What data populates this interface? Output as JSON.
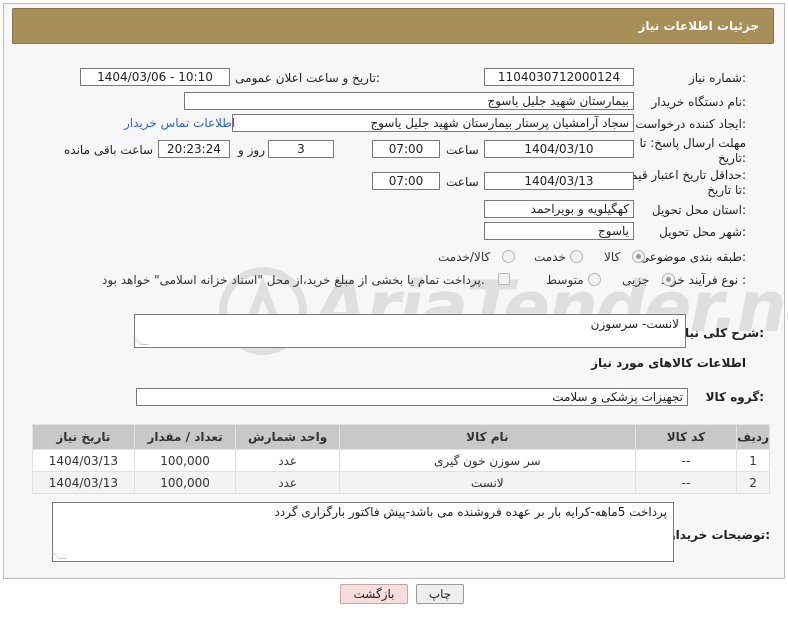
{
  "header": {
    "title": "جزئیات اطلاعات نیاز"
  },
  "fields": {
    "need_number_label": "شماره نیاز:",
    "need_number": "1104030712000124",
    "announce_label": "تاریخ و ساعت اعلان عمومی:",
    "announce_value": "1404/03/06 - 10:10",
    "buyer_org_label": "نام دستگاه خریدار:",
    "buyer_org": "بیمارستان شهید جلیل یاسوج",
    "creator_label": "ایجاد کننده درخواست:",
    "creator": "سجاد آرامشیان پرستار بیمارستان شهید جلیل یاسوج",
    "contact_link": "اطلاعات تماس خریدار",
    "deadline_label_1": "مهلت ارسال پاسخ: تا",
    "deadline_label_2": "تاریخ:",
    "deadline_date": "1404/03/10",
    "time_label": "ساعت",
    "deadline_time": "07:00",
    "days_value": "3",
    "days_label": "روز و",
    "remaining_time": "20:23:24",
    "remaining_label": "ساعت باقی مانده",
    "validity_label_1": "حداقل تاریخ اعتبار قیمت:",
    "validity_label_2": "تا تاریخ:",
    "validity_date": "1404/03/13",
    "validity_time": "07:00",
    "province_label": "استان محل تحویل:",
    "province": "کهگیلویه و بویراحمد",
    "city_label": "شهر محل تحویل:",
    "city": "یاسوج",
    "category_label": "طبقه بندی موضوعی:",
    "category_options": [
      "کالا",
      "خدمت",
      "کالا/خدمت"
    ],
    "process_label": "نوع فرآیند خرید :",
    "process_options": [
      "جزیی",
      "متوسط"
    ],
    "payment_note": "پرداخت تمام یا بخشی از مبلغ خرید،از محل \"اسناد خزانه اسلامی\" خواهد بود."
  },
  "summary": {
    "label": "شرح کلی نیاز:",
    "value": "لانست- سرسوزن"
  },
  "goods_section_title": "اطلاعات کالاهای مورد نیاز",
  "goods_group": {
    "label": "گروه کالا:",
    "value": "تجهیزات پزشکی و سلامت"
  },
  "table": {
    "headers": [
      "ردیف",
      "کد کالا",
      "نام کالا",
      "واحد شمارش",
      "تعداد / مقدار",
      "تاریخ نیاز"
    ],
    "rows": [
      [
        "1",
        "--",
        "سر سوزن خون گیری",
        "عدد",
        "100,000",
        "1404/03/13"
      ],
      [
        "2",
        "--",
        "لانست",
        "عدد",
        "100,000",
        "1404/03/13"
      ]
    ]
  },
  "buyer_notes": {
    "label": "توضیحات خریدار:",
    "value": "پرداخت 5ماهه-کرایه بار بر عهده فروشنده می باشد-پیش فاکتور بارگزاری گردد"
  },
  "buttons": {
    "print": "چاپ",
    "back": "بازگشت"
  },
  "watermark": {
    "text": "AriaTender.net"
  },
  "colors": {
    "header_bg": "#a88e59",
    "link": "#2a68c8",
    "back_button_bg": "#f7dede"
  }
}
